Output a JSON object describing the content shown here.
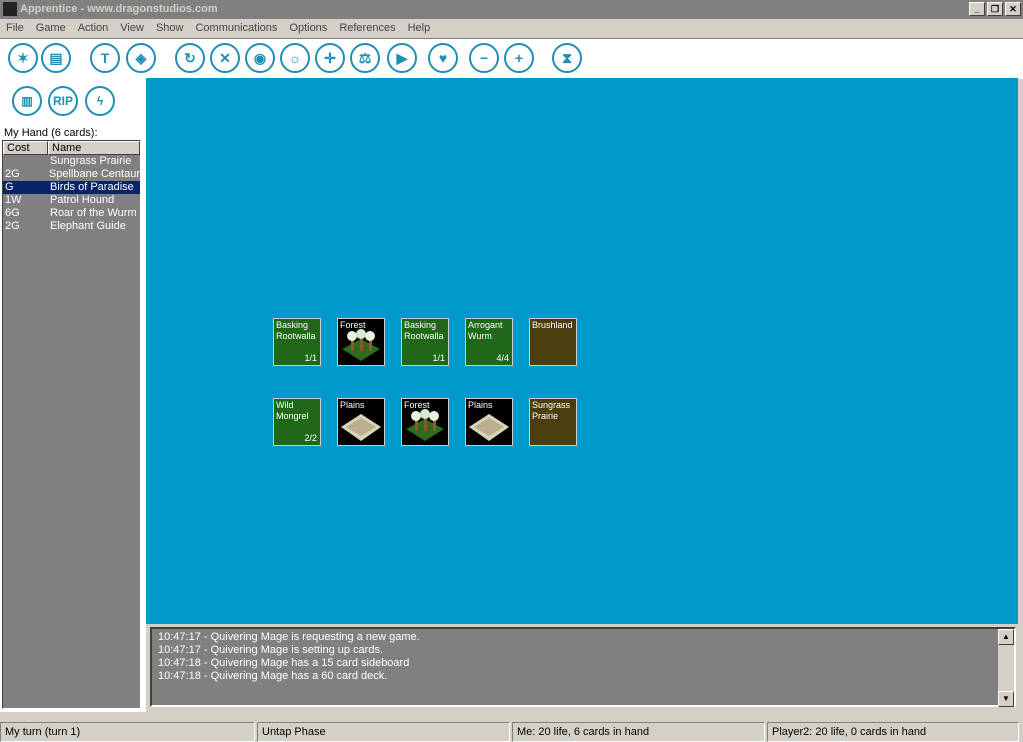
{
  "window": {
    "title": "Apprentice - www.dragonstudios.com"
  },
  "menu": [
    "File",
    "Game",
    "Action",
    "View",
    "Show",
    "Communications",
    "Options",
    "References",
    "Help"
  ],
  "toolbar_icons": [
    "star-burst-icon",
    "cards-icon",
    "hammer-icon",
    "tag-icon",
    "refresh-icon",
    "tools-icon",
    "eye-icon",
    "sun-icon",
    "crosshair-icon",
    "scales-icon",
    "play-icon",
    "heart-icon",
    "heart-minus-icon",
    "heart-plus-icon",
    "hourglass-icon"
  ],
  "left_icons": [
    "book-icon",
    "rip-icon",
    "lightning-icon"
  ],
  "rip_text": "RIP",
  "hand": {
    "label": "My Hand (6 cards):",
    "cost_header": "Cost",
    "name_header": "Name",
    "cards": [
      {
        "cost": "",
        "name": "Sungrass Prairie"
      },
      {
        "cost": "2G",
        "name": "Spellbane Centaur"
      },
      {
        "cost": "G",
        "name": "Birds of Paradise"
      },
      {
        "cost": "1W",
        "name": "Patrol Hound"
      },
      {
        "cost": "6G",
        "name": "Roar of the Wurm"
      },
      {
        "cost": "2G",
        "name": "Elephant Guide"
      }
    ]
  },
  "battlefield": {
    "row1": [
      {
        "name": "Basking Rootwalla",
        "pt": "1/1",
        "kind": "green"
      },
      {
        "name": "Forest",
        "pt": "",
        "kind": "forest"
      },
      {
        "name": "Basking Rootwalla",
        "pt": "1/1",
        "kind": "green"
      },
      {
        "name": "Arrogant Wurm",
        "pt": "4/4",
        "kind": "green"
      },
      {
        "name": "Brushland",
        "pt": "",
        "kind": "brown"
      }
    ],
    "row2": [
      {
        "name": "Wild Mongrel",
        "pt": "2/2",
        "kind": "green"
      },
      {
        "name": "Plains",
        "pt": "",
        "kind": "plains"
      },
      {
        "name": "Forest",
        "pt": "",
        "kind": "forest"
      },
      {
        "name": "Plains",
        "pt": "",
        "kind": "plains"
      },
      {
        "name": "Sungrass Prairie",
        "pt": "",
        "kind": "brown"
      }
    ]
  },
  "log": [
    "10:47:17 - Quivering Mage is requesting a new game.",
    "10:47:17 - Quivering Mage is setting up cards.",
    "10:47:18 - Quivering Mage has a 15 card sideboard",
    "10:47:18 - Quivering Mage has a 60 card deck."
  ],
  "status": {
    "turn": "My turn (turn 1)",
    "phase": "Untap Phase",
    "me": "Me: 20 life, 6 cards in hand",
    "opponent": "Player2: 20 life, 0 cards in hand"
  },
  "colors": {
    "playfield": "#0099cc",
    "accent": "#1f8fb5",
    "creature": "#206818",
    "land": "#4a3e0e"
  }
}
